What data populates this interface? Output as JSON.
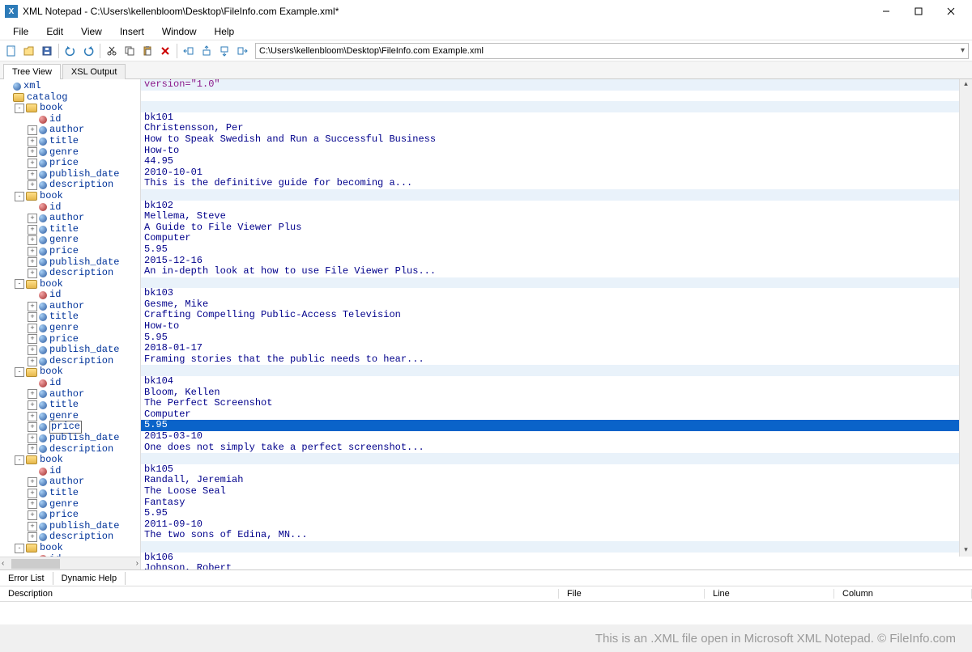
{
  "window": {
    "app_icon_letter": "X",
    "title": "XML Notepad - C:\\Users\\kellenbloom\\Desktop\\FileInfo.com Example.xml*"
  },
  "menu": [
    "File",
    "Edit",
    "View",
    "Insert",
    "Window",
    "Help"
  ],
  "toolbar": {
    "path": "C:\\Users\\kellenbloom\\Desktop\\FileInfo.com Example.xml"
  },
  "tabs": {
    "tree_view": "Tree View",
    "xsl_output": "XSL Output"
  },
  "tree_root": {
    "xml": "xml",
    "catalog": "catalog",
    "book": "book",
    "fields": [
      "id",
      "author",
      "title",
      "genre",
      "price",
      "publish_date",
      "description"
    ]
  },
  "xml_decl": "version=\"1.0\"",
  "books": [
    {
      "id": "bk101",
      "author": "Christensson, Per",
      "title": "How to Speak Swedish and Run a Successful Business",
      "genre": "How-to",
      "price": "44.95",
      "publish_date": "2010-10-01",
      "description": "This is the definitive guide for becoming a..."
    },
    {
      "id": "bk102",
      "author": "Mellema, Steve",
      "title": "A Guide to File Viewer Plus",
      "genre": "Computer",
      "price": "5.95",
      "publish_date": "2015-12-16",
      "description": "An in-depth look at how to use File Viewer Plus..."
    },
    {
      "id": "bk103",
      "author": "Gesme, Mike",
      "title": "Crafting Compelling Public-Access Television",
      "genre": "How-to",
      "price": "5.95",
      "publish_date": "2018-01-17",
      "description": "Framing stories that the public needs to hear..."
    },
    {
      "id": "bk104",
      "author": "Bloom, Kellen",
      "title": "The Perfect Screenshot",
      "genre": "Computer",
      "price": "5.95",
      "publish_date": "2015-03-10",
      "description": "One does not simply take a perfect screenshot..."
    },
    {
      "id": "bk105",
      "author": "Randall, Jeremiah",
      "title": "The Loose Seal",
      "genre": "Fantasy",
      "price": "5.95",
      "publish_date": "2011-09-10",
      "description": "The two sons of Edina, MN..."
    },
    {
      "id": "bk106",
      "author": "Johnson, Robert"
    }
  ],
  "selected": {
    "book_index": 3,
    "field": "price"
  },
  "bottom_tabs": {
    "error_list": "Error List",
    "dynamic_help": "Dynamic Help"
  },
  "err_cols": {
    "description": "Description",
    "file": "File",
    "line": "Line",
    "column": "Column"
  },
  "watermark": "This is an .XML file open in Microsoft XML Notepad. © FileInfo.com"
}
